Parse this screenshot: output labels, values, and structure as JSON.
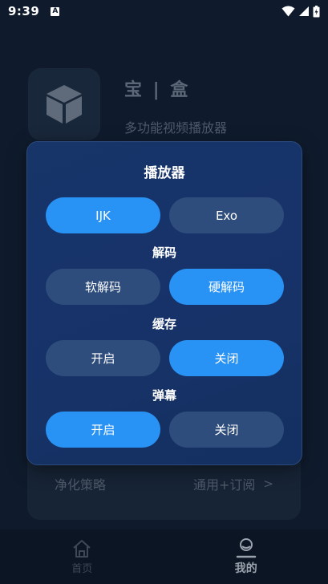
{
  "status_bar": {
    "time": "9:39",
    "notification_badge": "A",
    "icons": [
      "wifi-icon",
      "signal-icon",
      "battery-icon"
    ]
  },
  "app": {
    "title": "宝 | 盒",
    "subtitle": "多功能视频播放器",
    "icon": "cube-icon"
  },
  "settings": {
    "filter_label": "净化策略",
    "filter_value": "通用+订阅",
    "chevron": ">"
  },
  "bottom_nav": {
    "items": [
      {
        "label": "首页",
        "icon": "home-icon",
        "active": false
      },
      {
        "label": "我的",
        "icon": "profile-icon",
        "active": true
      }
    ]
  },
  "dialog": {
    "title": "播放器",
    "player": {
      "options": [
        {
          "label": "IJK",
          "selected": true
        },
        {
          "label": "Exo",
          "selected": false
        }
      ]
    },
    "decoding": {
      "label": "解码",
      "options": [
        {
          "label": "软解码",
          "selected": false
        },
        {
          "label": "硬解码",
          "selected": true
        }
      ]
    },
    "cache": {
      "label": "缓存",
      "options": [
        {
          "label": "开启",
          "selected": false
        },
        {
          "label": "关闭",
          "selected": true
        }
      ]
    },
    "danmaku": {
      "label": "弹幕",
      "options": [
        {
          "label": "开启",
          "selected": true
        },
        {
          "label": "关闭",
          "selected": false
        }
      ]
    }
  },
  "colors": {
    "selected": "#2892f5",
    "unselected": "#2e4d7c",
    "dialog_bg": "#17336a",
    "page_bg": "#0f1b2d"
  }
}
